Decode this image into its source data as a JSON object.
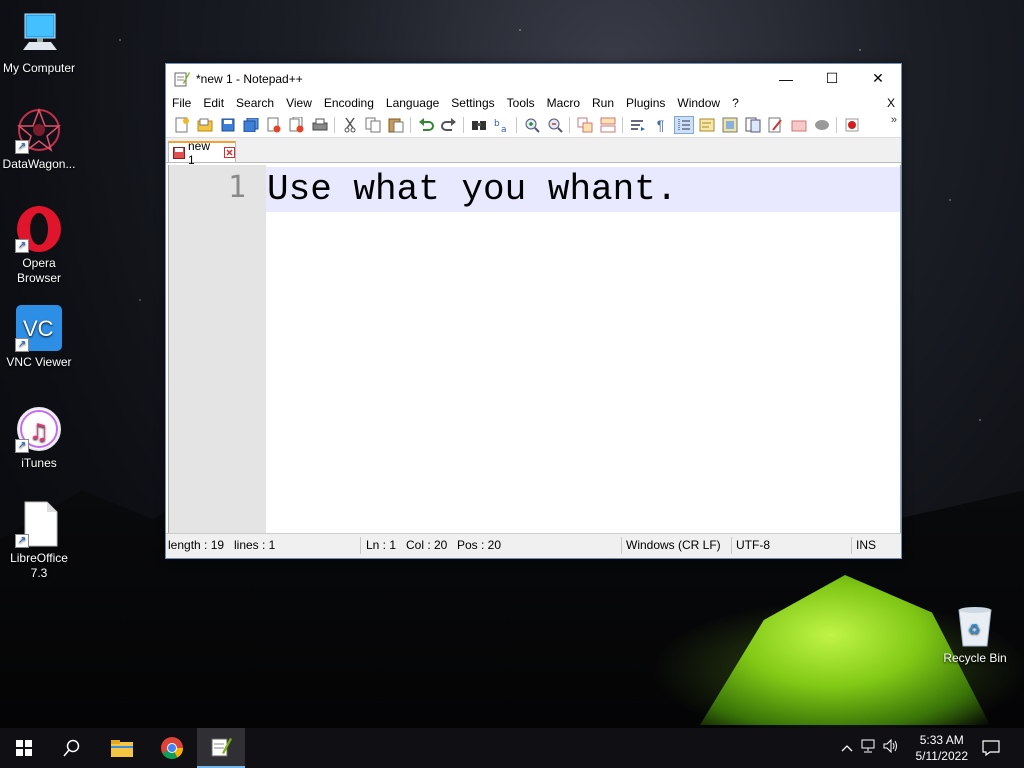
{
  "desktop": {
    "icons": [
      {
        "label": "My Computer"
      },
      {
        "label": "DataWagon..."
      },
      {
        "label": "Opera\nBrowser"
      },
      {
        "label": "VNC Viewer"
      },
      {
        "label": "iTunes"
      },
      {
        "label": "LibreOffice\n7.3"
      }
    ],
    "recycle_bin": "Recycle Bin"
  },
  "window": {
    "title": "*new 1 - Notepad++",
    "minimize": "—",
    "maximize": "☐",
    "close": "✕",
    "menu": [
      "File",
      "Edit",
      "Search",
      "View",
      "Encoding",
      "Language",
      "Settings",
      "Tools",
      "Macro",
      "Run",
      "Plugins",
      "Window",
      "?"
    ],
    "menu_close": "X",
    "toolbar_more": "»",
    "tab": {
      "label": "new 1"
    },
    "editor": {
      "line_number": "1",
      "line_text": "Use what you whant."
    },
    "status": {
      "length": "length : 19",
      "lines": "lines : 1",
      "ln": "Ln : 1",
      "col": "Col : 20",
      "pos": "Pos : 20",
      "eol": "Windows (CR LF)",
      "encoding": "UTF-8",
      "mode": "INS"
    }
  },
  "taskbar": {
    "time": "5:33 AM",
    "date": "5/11/2022"
  }
}
